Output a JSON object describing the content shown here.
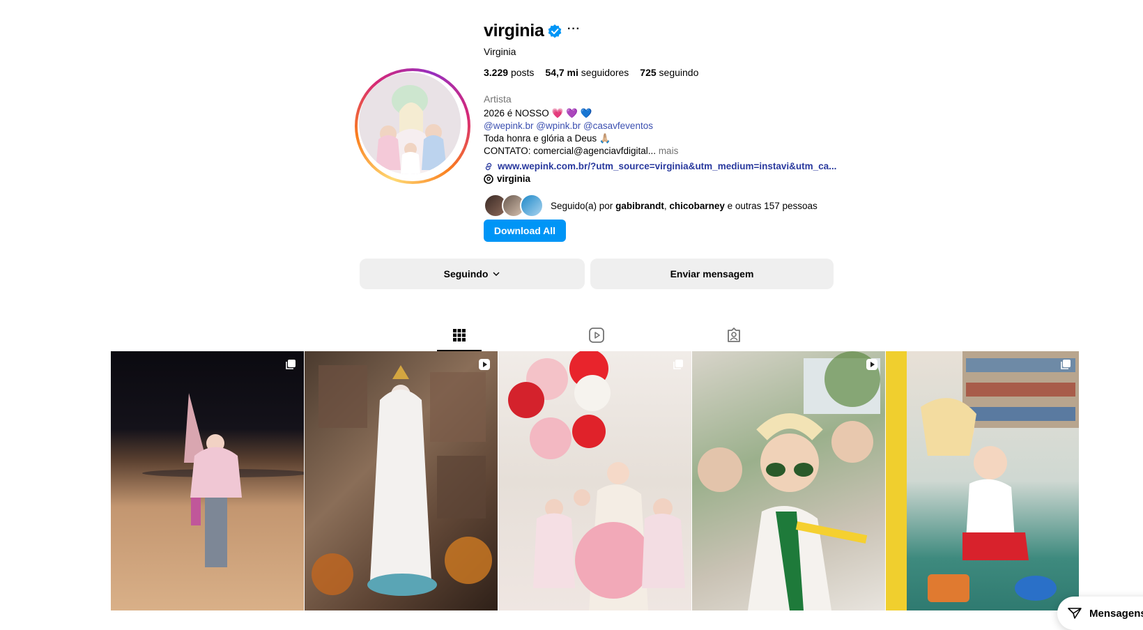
{
  "profile": {
    "username": "virginia",
    "full_name": "Virginia",
    "stats": {
      "posts_count": "3.229",
      "posts_label": "posts",
      "followers_count": "54,7 mi",
      "followers_label": "seguidores",
      "following_count": "725",
      "following_label": "seguindo"
    },
    "category": "Artista",
    "bio_line1": "2026 é NOSSO 💗 💜 💙",
    "bio_mentions": "@wepink.br @wpink.br @casavfeventos",
    "bio_line3": "Toda honra e glória a Deus 🙏🏼",
    "bio_line4": "CONTATO: comercial@agenciavfdigital...",
    "bio_more": "mais",
    "link": "www.wepink.com.br/?utm_source=virginia&utm_medium=instavi&utm_ca...",
    "threads_handle": "virginia",
    "followed_by_prefix": "Seguido(a) por",
    "followed_by_user1": "gabibrandt",
    "followed_by_sep": ",",
    "followed_by_user2": "chicobarney",
    "followed_by_suffix": "e outras 157 pessoas",
    "download_label": "Download All",
    "following_button": "Seguindo",
    "message_button": "Enviar mensagem"
  },
  "tabs": [
    {
      "icon": "grid-icon",
      "active": true
    },
    {
      "icon": "reels-icon",
      "active": false
    },
    {
      "icon": "tagged-icon",
      "active": false
    }
  ],
  "posts": [
    {
      "type": "carousel",
      "icon": "carousel-icon"
    },
    {
      "type": "reel",
      "icon": "reel-icon"
    },
    {
      "type": "carousel",
      "icon": "carousel-icon"
    },
    {
      "type": "reel",
      "icon": "reel-icon"
    },
    {
      "type": "carousel",
      "icon": "carousel-icon"
    }
  ],
  "messages_pill": {
    "label": "Mensagens"
  },
  "colors": {
    "primary_button": "#0095f6",
    "verified": "#0095f6",
    "secondary_button": "#efefef",
    "link": "#2a3a9e"
  }
}
